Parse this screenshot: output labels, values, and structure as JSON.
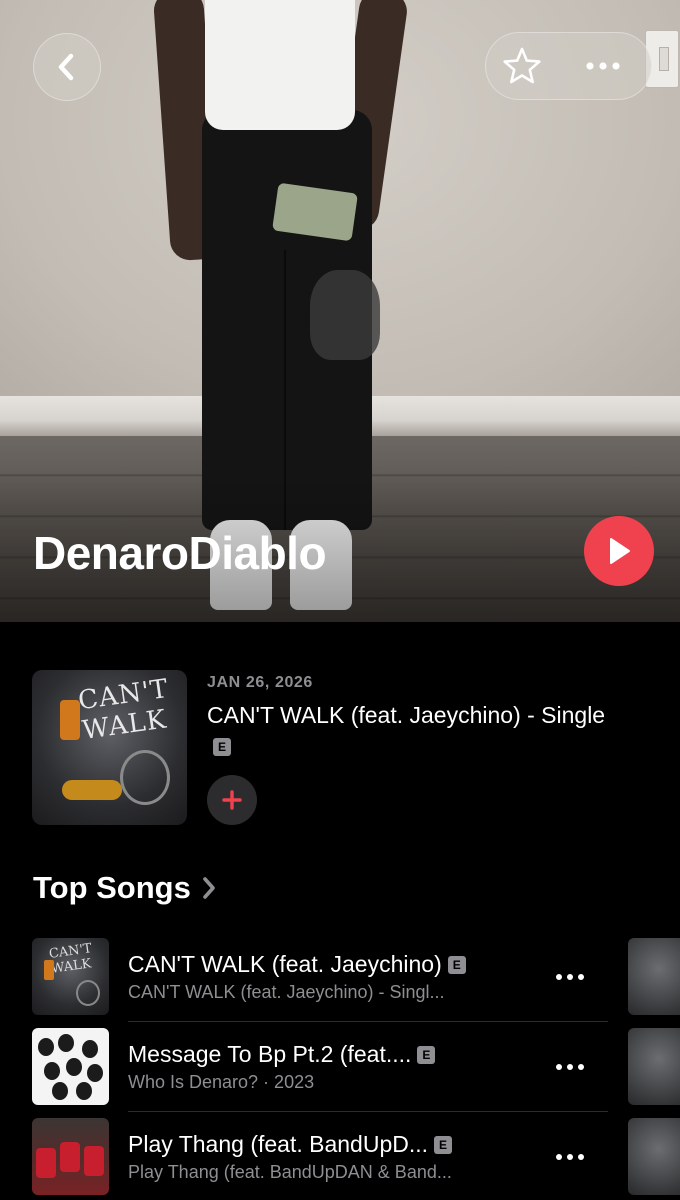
{
  "artist": {
    "name": "DenaroDiablo"
  },
  "header": {
    "back_icon": "chevron-left-icon",
    "favorite_icon": "star-outline-icon",
    "more_icon": "ellipsis-icon"
  },
  "colors": {
    "accent": "#f0424e",
    "secondary_text": "#8e8e93",
    "background": "#000000"
  },
  "latest_release": {
    "date": "JAN 26, 2026",
    "title": "CAN'T WALK (feat. Jaeychino) - Single",
    "explicit_badge": "E",
    "add_icon": "plus-icon"
  },
  "top_songs": {
    "title": "Top Songs",
    "items": [
      {
        "title": "CAN'T WALK (feat. Jaeychino)",
        "subtitle": "CAN'T WALK (feat. Jaeychino) - Singl...",
        "explicit": "E"
      },
      {
        "title": "Message To Bp Pt.2 (feat....",
        "subtitle": "Who Is Denaro? · 2023",
        "explicit": "E"
      },
      {
        "title": "Play Thang (feat. BandUpD...",
        "subtitle": "Play Thang (feat. BandUpDAN & Band...",
        "explicit": "E"
      }
    ]
  }
}
